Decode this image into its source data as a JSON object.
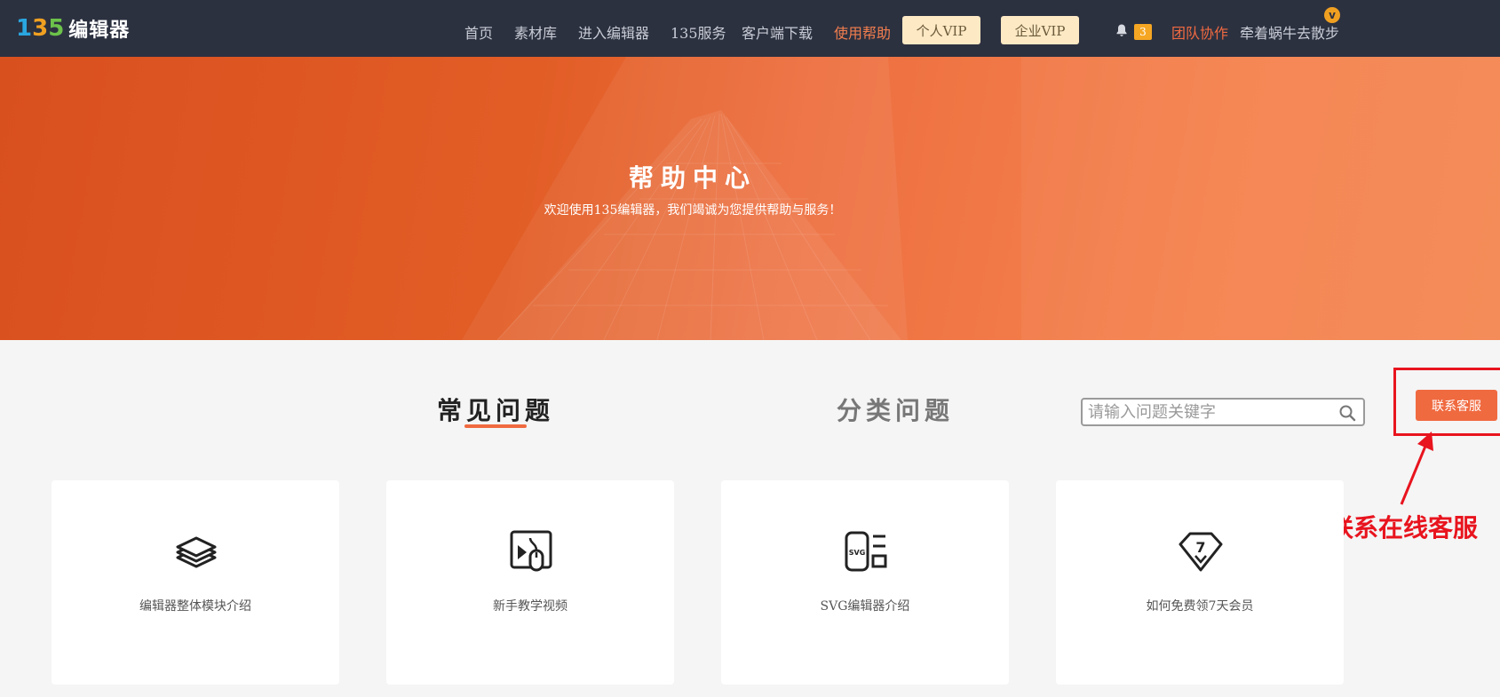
{
  "header": {
    "logo_text": "编辑器",
    "logo_mark": [
      "1",
      "3",
      "5"
    ],
    "nav": [
      "首页",
      "素材库",
      "进入编辑器",
      "135服务",
      "客户端下载",
      "使用帮助"
    ],
    "active_nav": "使用帮助",
    "vip_personal": "个人VIP",
    "vip_enterprise": "企业VIP",
    "notification_count": "3",
    "team": "团队协作",
    "username": "牵着蜗牛去散步",
    "user_badge": "v"
  },
  "banner": {
    "title": "帮助中心",
    "subtitle": "欢迎使用135编辑器，我们竭诚为您提供帮助与服务！"
  },
  "tabs": {
    "common": "常见问题",
    "category": "分类问题",
    "active": "常见问题"
  },
  "search": {
    "placeholder": "请输入问题关键字"
  },
  "contact": {
    "button": "联系客服",
    "annotation": "联系在线客服"
  },
  "cards": [
    {
      "label": "编辑器整体模块介绍",
      "icon": "layers-icon"
    },
    {
      "label": "新手教学视频",
      "icon": "video-tutorial-icon"
    },
    {
      "label": "SVG编辑器介绍",
      "icon": "svg-editor-icon",
      "icon_text": "SVG"
    },
    {
      "label": "如何免费领7天会员",
      "icon": "diamond-7-icon",
      "icon_text": "7"
    }
  ],
  "colors": {
    "header_bg": "#2c3140",
    "accent": "#f06a40",
    "vip_bg": "#fde9c4",
    "annotation": "#e8141e"
  }
}
